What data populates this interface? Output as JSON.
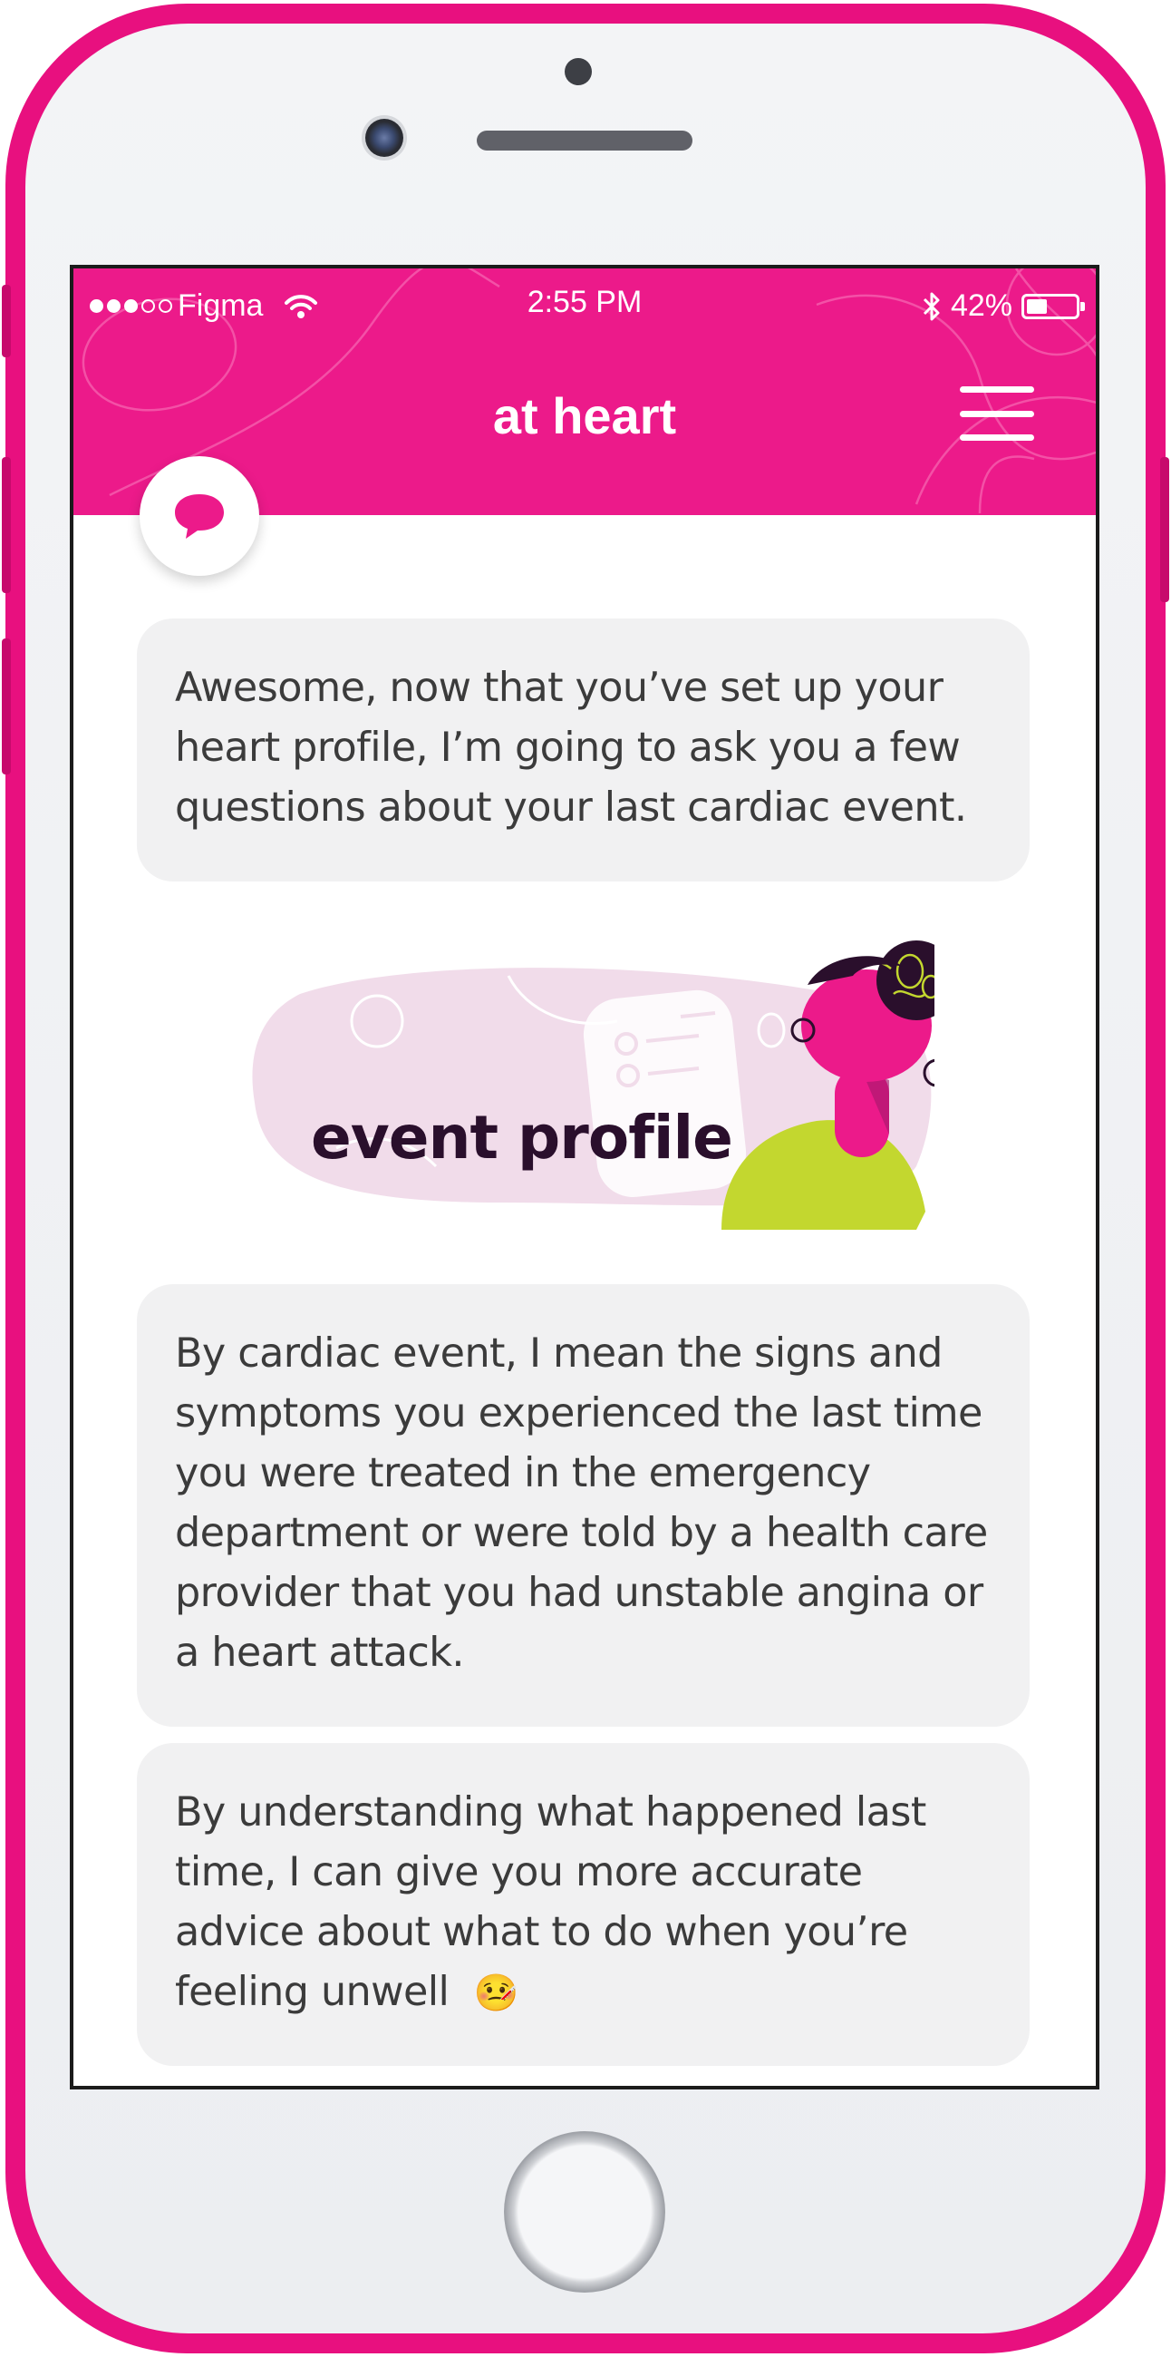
{
  "status_bar": {
    "carrier": "Figma",
    "time": "2:55 PM",
    "battery_percent": "42%",
    "battery_level": 0.42
  },
  "header": {
    "title": "at heart"
  },
  "messages": [
    "Awesome, now that you’ve set up your heart profile, I’m going to ask you a few questions about your last cardiac event.",
    "By cardiac event, I mean the signs and symptoms you experienced the last time you were treated in the emergency department or were told by a health care provider that you had unstable angina or a heart attack.",
    "By understanding what happened last time, I can give you more accurate advice about what to do when you’re feeling unwell"
  ],
  "illustration": {
    "title": "event profile"
  },
  "emoji": "🤒",
  "colors": {
    "brand_pink": "#ec1a8a",
    "device_pink": "#e8107f",
    "bubble_gray": "#f1f1f2",
    "accent_green": "#c3d72f",
    "dark_purple": "#2a0f2c"
  }
}
